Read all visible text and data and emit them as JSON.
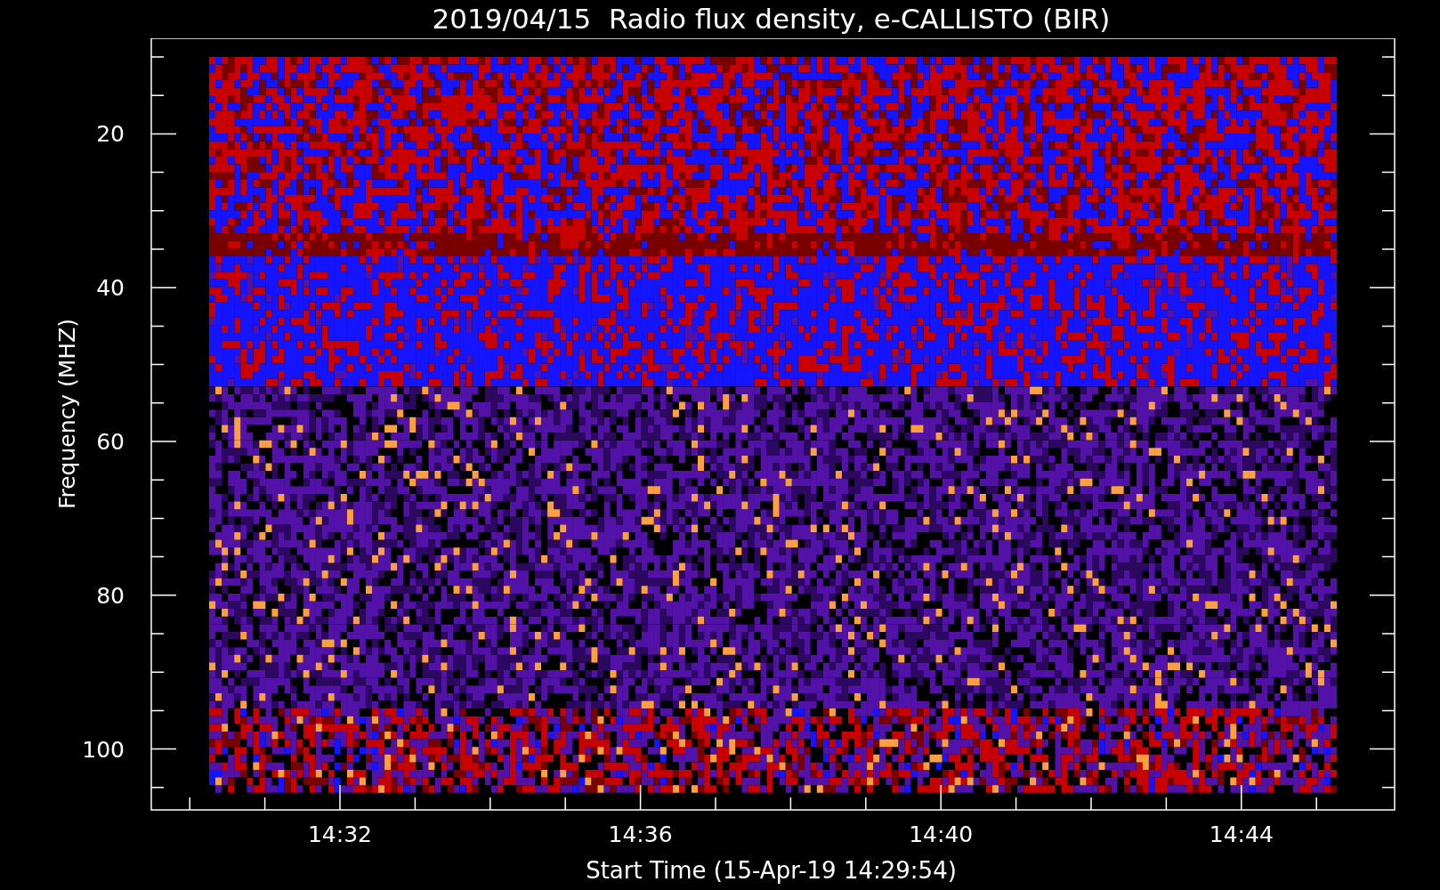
{
  "title": "2019/04/15  Radio flux density, e-CALLISTO (BIR)",
  "y_axis": {
    "label": "Frequency (MHZ)",
    "ticks": [
      "20",
      "40",
      "60",
      "80",
      "100"
    ]
  },
  "x_axis": {
    "label": "Start Time (15-Apr-19 14:29:54)",
    "ticks": [
      "14:32",
      "14:36",
      "14:40",
      "14:44"
    ]
  }
}
